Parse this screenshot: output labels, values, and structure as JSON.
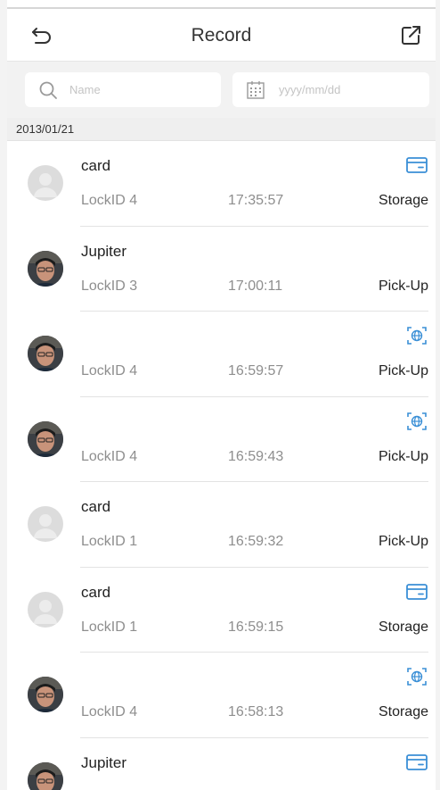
{
  "header": {
    "title": "Record"
  },
  "search": {
    "name_placeholder": "Name",
    "date_placeholder": "yyyy/mm/dd"
  },
  "date_group": "2013/01/21",
  "colors": {
    "accent": "#3a8fd6",
    "placeholder_avatar": "#dcdcdc"
  },
  "records": [
    {
      "name": "card",
      "lock": "LockID 4",
      "time": "17:35:57",
      "action": "Storage",
      "type_icon": "card-icon",
      "avatar": "placeholder-avatar"
    },
    {
      "name": "Jupiter",
      "lock": "LockID 3",
      "time": "17:00:11",
      "action": "Pick-Up",
      "type_icon": "",
      "avatar": "user-photo-avatar"
    },
    {
      "name": "",
      "lock": "LockID 4",
      "time": "16:59:57",
      "action": "Pick-Up",
      "type_icon": "face-scan-icon",
      "avatar": "user-photo-avatar"
    },
    {
      "name": "",
      "lock": "LockID 4",
      "time": "16:59:43",
      "action": "Pick-Up",
      "type_icon": "face-scan-icon",
      "avatar": "user-photo-avatar"
    },
    {
      "name": "card",
      "lock": "LockID 1",
      "time": "16:59:32",
      "action": "Pick-Up",
      "type_icon": "",
      "avatar": "placeholder-avatar"
    },
    {
      "name": "card",
      "lock": "LockID 1",
      "time": "16:59:15",
      "action": "Storage",
      "type_icon": "card-icon",
      "avatar": "placeholder-avatar"
    },
    {
      "name": "",
      "lock": "LockID 4",
      "time": "16:58:13",
      "action": "Storage",
      "type_icon": "face-scan-icon",
      "avatar": "user-photo-avatar"
    },
    {
      "name": "Jupiter",
      "lock": "",
      "time": "",
      "action": "",
      "type_icon": "card-icon",
      "avatar": "user-photo-avatar"
    }
  ]
}
